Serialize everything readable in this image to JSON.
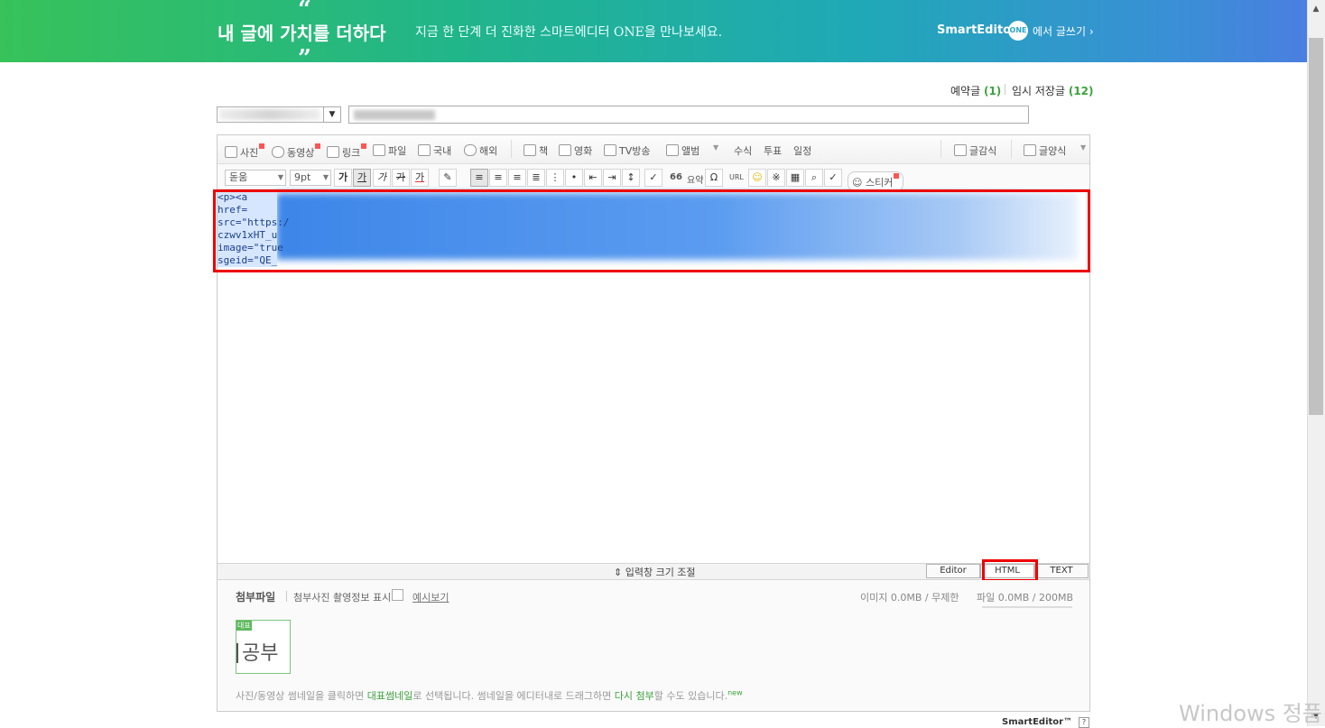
{
  "banner": {
    "quote_open": "“",
    "quote_close": "”",
    "headline": "내 글에 가치를 더하다",
    "subline": "지금 한 단계 더 진화한 스마트에디터 ONE을 만나보세요.",
    "brand": "SmartEditor",
    "brand_badge": "ONE",
    "write_link": "에서 글쓰기 ›"
  },
  "header": {
    "reserve_label": "예약글",
    "reserve_count": "(1)",
    "drafts_label": "임시 저장글",
    "drafts_count": "(12)"
  },
  "category": {
    "arrow": "▼"
  },
  "toolbar1": {
    "photo": "사진",
    "video": "동영상",
    "link": "링크",
    "file": "파일",
    "domestic": "국내",
    "overseas": "해외",
    "book": "책",
    "movie": "영화",
    "tv": "TV방송",
    "album": "앨범",
    "formula": "수식",
    "vote": "투표",
    "schedule": "일정",
    "quote_style": "글감식",
    "template": "글양식"
  },
  "toolbar2": {
    "font": "돋움",
    "size": "9pt",
    "bold": "가",
    "underline": "가",
    "italic": "가",
    "strike": "가",
    "color": "가",
    "quote": "66",
    "summary": "요약",
    "url": "URL",
    "sticker": "스티커"
  },
  "code": {
    "lines": [
      "<p><a href=",
      "src=\"https:/",
      "czwv1xHT_u",
      "image=\"true",
      "sgeid=\"QE_"
    ]
  },
  "resize": {
    "label": "⇕ 입력창 크기 조절",
    "modes": [
      "Editor",
      "HTML",
      "TEXT"
    ]
  },
  "attach": {
    "title": "첨부파일",
    "exif_label": "첨부사진 촬영정보 표시",
    "preview_link": "예시보기",
    "image_usage": "이미지 0.0MB / 무제한",
    "file_usage": "파일 0.0MB / 200MB",
    "thumb_badge": "대표",
    "thumb_text": "공부",
    "help_1": "사진/동영상 썸네일을 클릭하면 ",
    "help_2": "대표썸네일",
    "help_3": "로 선택됩니다. 썸네일을 에디터내로 드래그하면 ",
    "help_4": "다시 첨부",
    "help_5": "할 수도 있습니다.",
    "help_new": "new"
  },
  "footer": {
    "editor_brand": "SmartEditor™",
    "help_icon": "?"
  },
  "watermark": "Windows 정품",
  "colors": {
    "highlight_red": "#e00000",
    "accent_green": "#3ca23c",
    "selection_blue": "#3d86e8"
  }
}
